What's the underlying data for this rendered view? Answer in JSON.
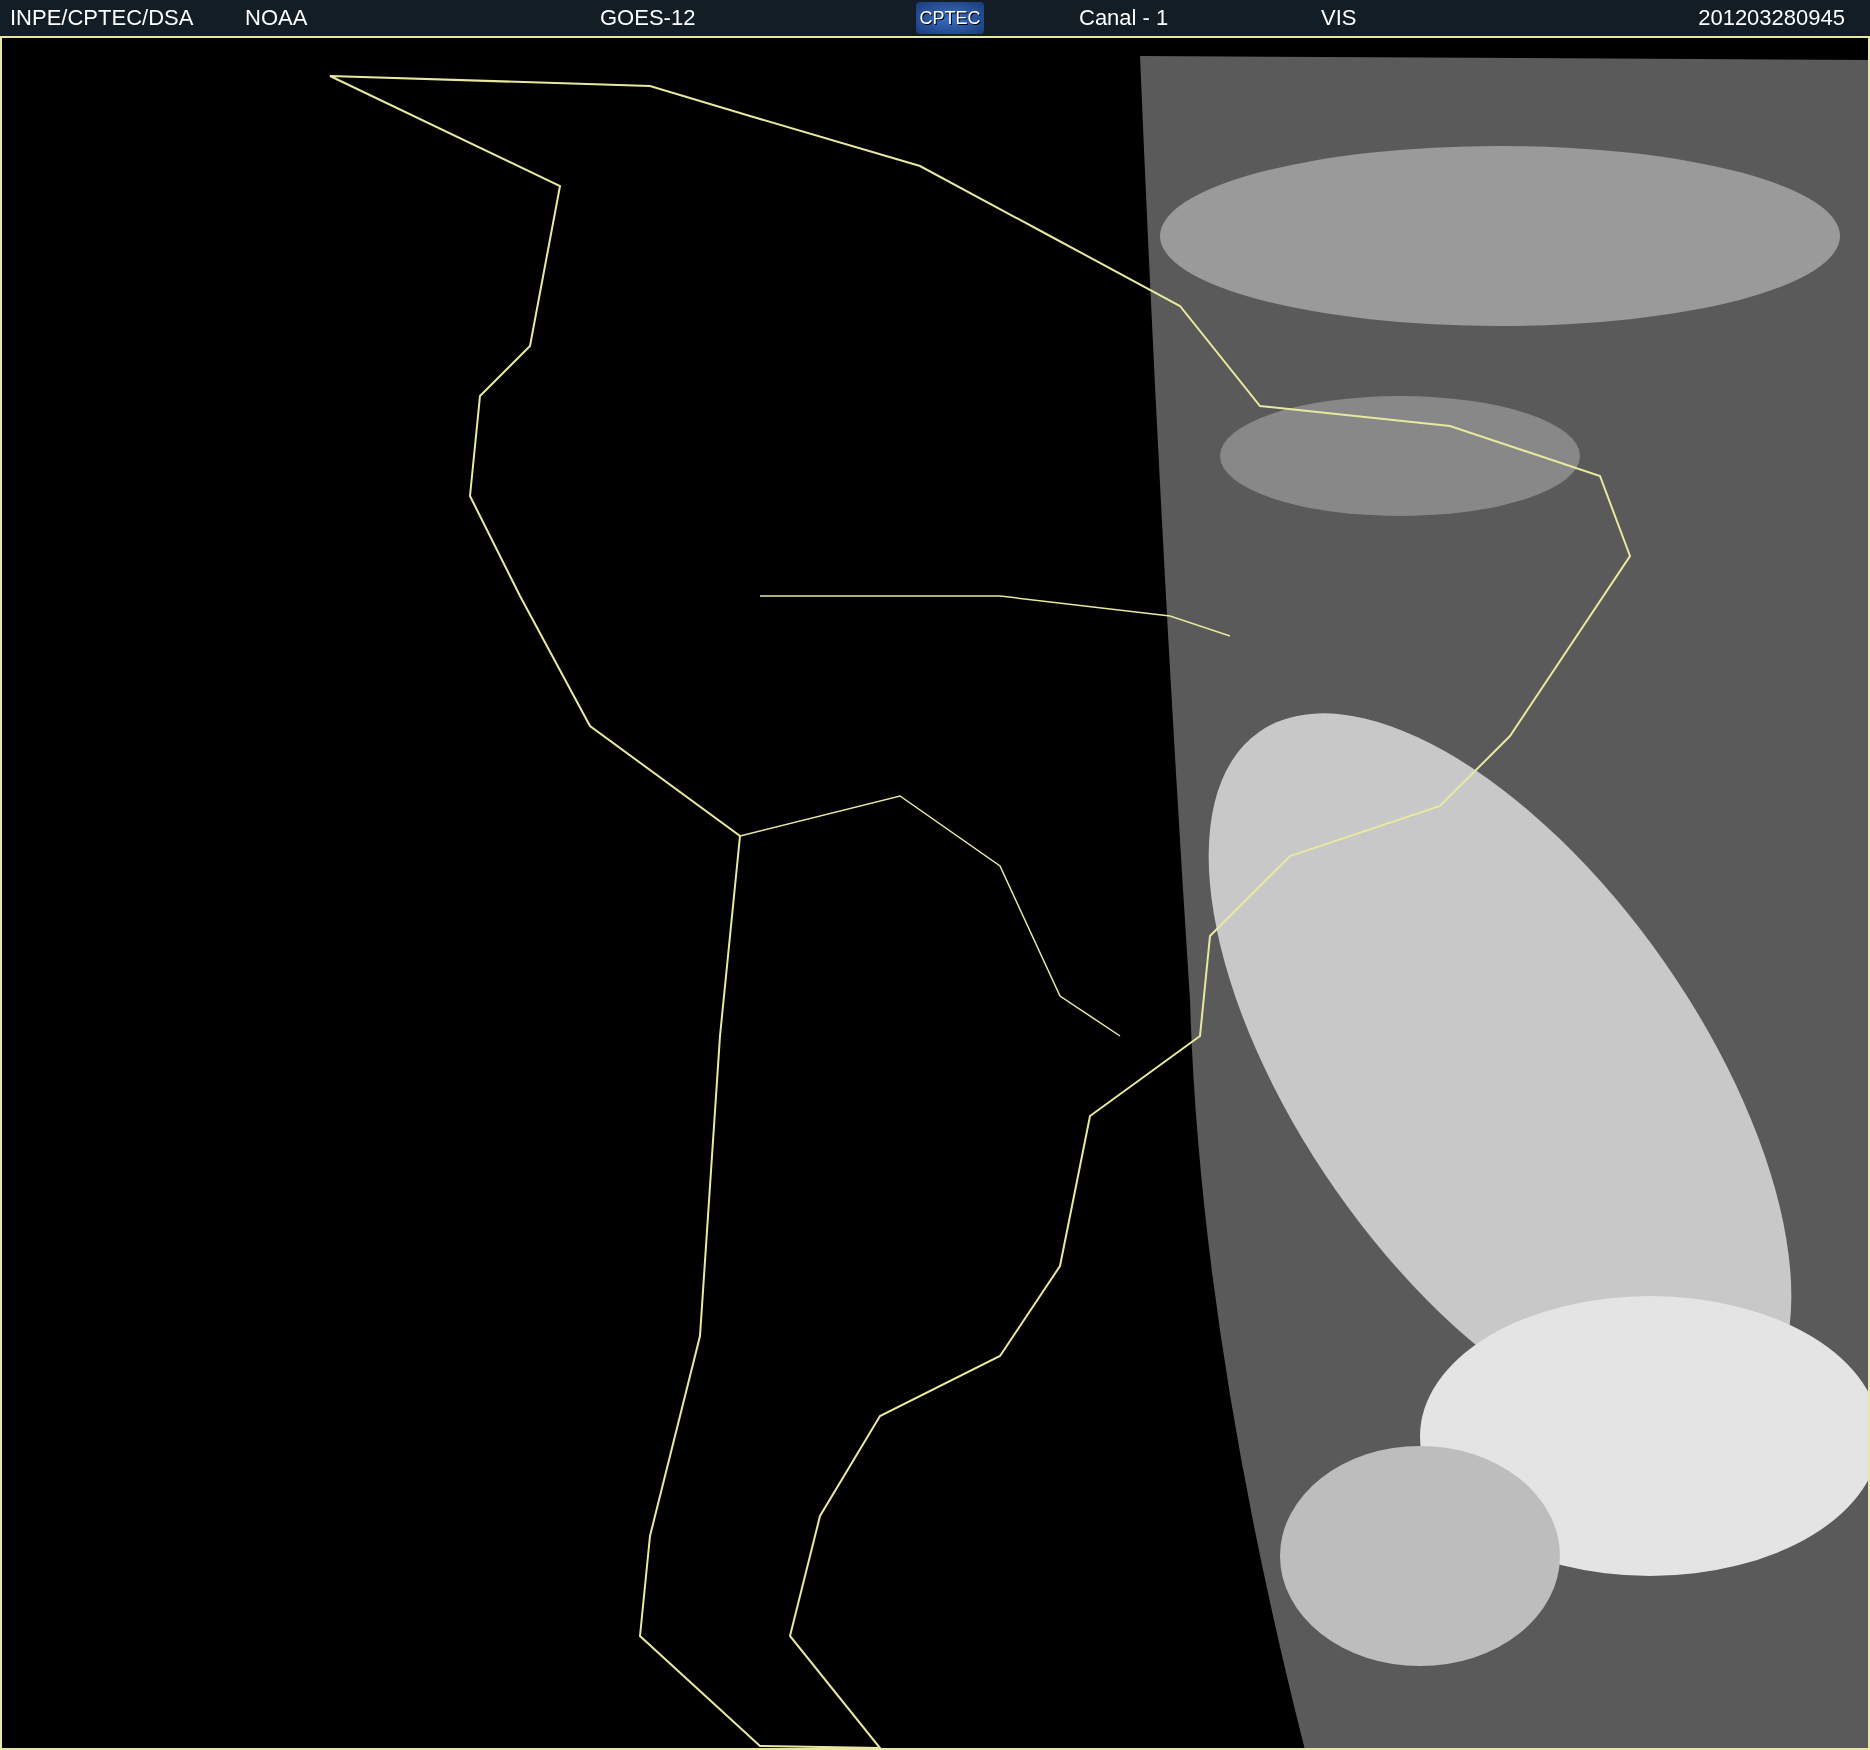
{
  "header": {
    "source": "INPE/CPTEC/DSA",
    "agency": "NOAA",
    "satellite": "GOES-12",
    "logo": "CPTEC",
    "channel": "Canal - 1",
    "band": "VIS",
    "timestamp": "201203280945"
  }
}
